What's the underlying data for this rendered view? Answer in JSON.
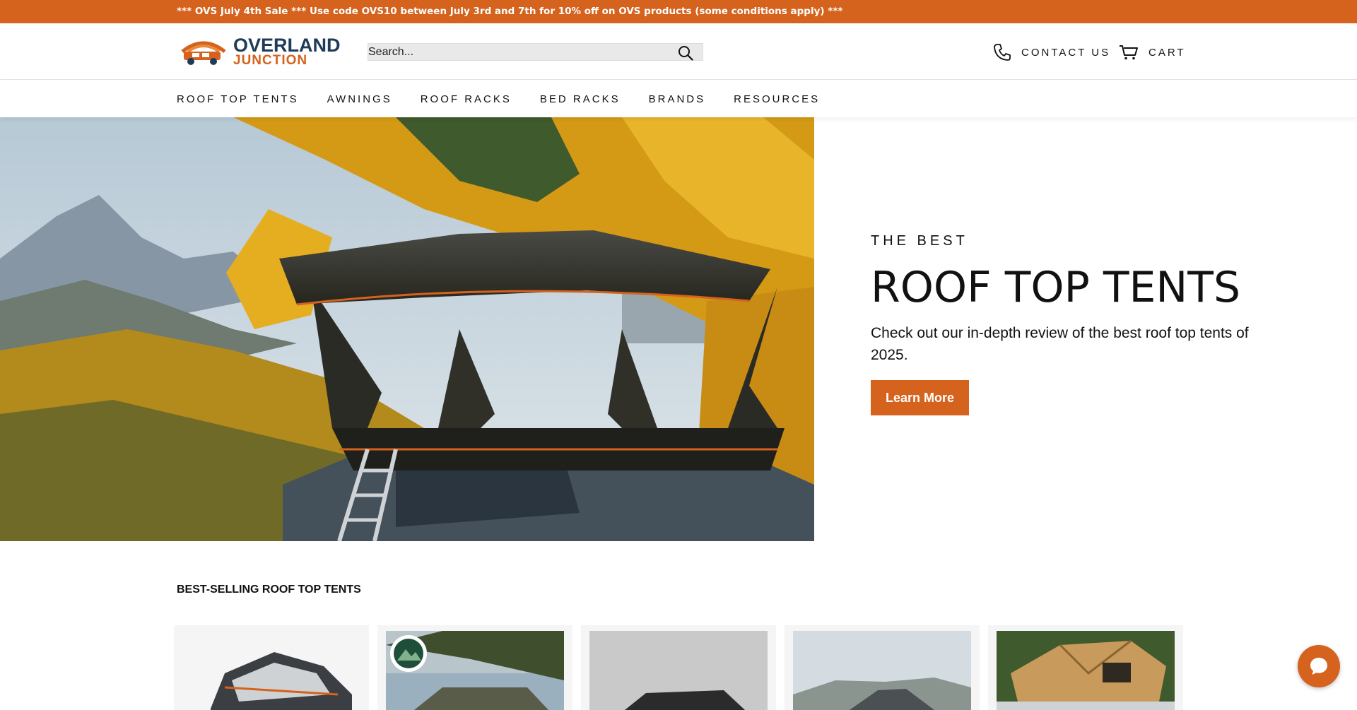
{
  "announcement": {
    "text": "*** OVS July 4th Sale *** Use code OVS10 between July 3rd and 7th for 10% off on OVS products (some conditions apply) ***"
  },
  "header": {
    "logo": {
      "line1": "OVERLAND",
      "line2": "JUNCTION"
    },
    "search": {
      "placeholder": "Search..."
    },
    "contact_label": "CONTACT US",
    "cart_label": "CART"
  },
  "nav": {
    "items": [
      {
        "label": "ROOF TOP TENTS"
      },
      {
        "label": "AWNINGS"
      },
      {
        "label": "ROOF RACKS"
      },
      {
        "label": "BED RACKS"
      },
      {
        "label": "BRANDS"
      },
      {
        "label": "RESOURCES"
      }
    ]
  },
  "hero": {
    "eyebrow": "THE BEST",
    "title": "ROOF TOP TENTS",
    "description": "Check out our in-depth review of the best roof top tents of 2025.",
    "button_label": "Learn More"
  },
  "best_selling": {
    "title": "BEST-SELLING ROOF TOP TENTS"
  },
  "colors": {
    "accent": "#d5621d",
    "logo_navy": "#1e3b5a",
    "text": "#111111"
  },
  "icons": {
    "search": "search-icon",
    "phone": "phone-icon",
    "cart": "cart-icon",
    "chat": "chat-icon"
  }
}
